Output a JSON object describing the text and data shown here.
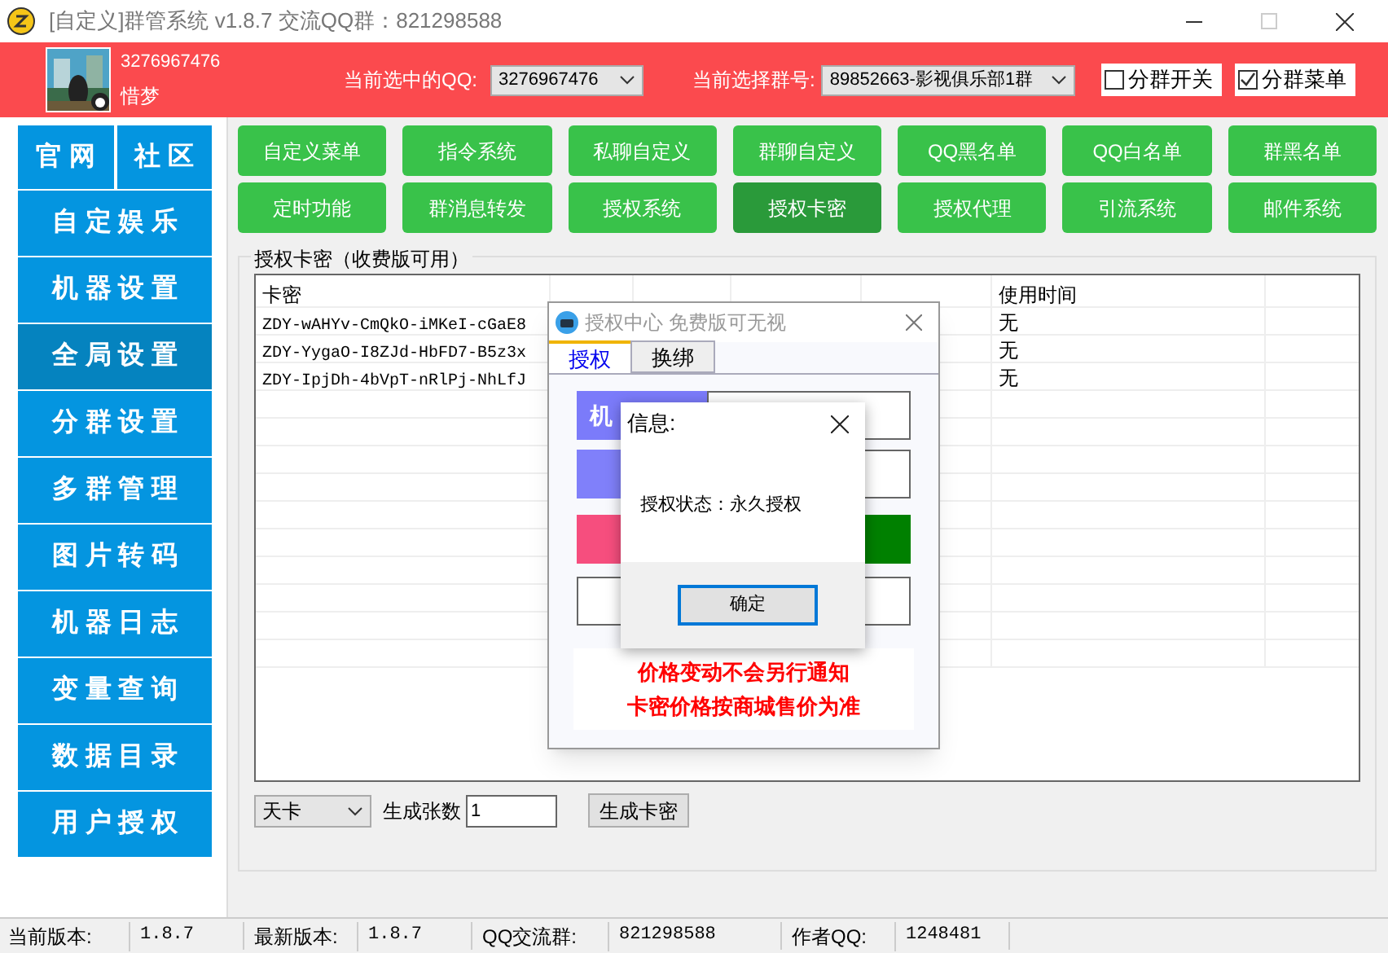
{
  "window": {
    "title": "[自定义]群管系统 v1.8.7 交流QQ群：821298588"
  },
  "header": {
    "account": {
      "qq": "3276967476",
      "nickname": "惜梦"
    },
    "qq_select": {
      "label": "当前选中的QQ:",
      "value": "3276967476"
    },
    "group_select": {
      "label": "当前选择群号:",
      "value": "89852663-影视俱乐部1群"
    },
    "checkboxes": [
      {
        "label": "分群开关",
        "checked": false
      },
      {
        "label": "分群菜单",
        "checked": true
      }
    ]
  },
  "sidebar": {
    "top_links": [
      "官 网",
      "社 区"
    ],
    "items": [
      {
        "label": "自 定 娱 乐",
        "selected": false
      },
      {
        "label": "机 器 设 置",
        "selected": false
      },
      {
        "label": "全 局 设 置",
        "selected": true
      },
      {
        "label": "分 群 设 置",
        "selected": false
      },
      {
        "label": "多 群 管 理",
        "selected": false
      },
      {
        "label": "图 片 转 码",
        "selected": false
      },
      {
        "label": "机 器 日 志",
        "selected": false
      },
      {
        "label": "变 量 查 询",
        "selected": false
      },
      {
        "label": "数 据 目 录",
        "selected": false
      },
      {
        "label": "用 户 授 权",
        "selected": false
      }
    ]
  },
  "feature_buttons": [
    {
      "label": "自定义菜单",
      "selected": false
    },
    {
      "label": "指令系统",
      "selected": false
    },
    {
      "label": "私聊自定义",
      "selected": false
    },
    {
      "label": "群聊自定义",
      "selected": false
    },
    {
      "label": "QQ黑名单",
      "selected": false
    },
    {
      "label": "QQ白名单",
      "selected": false
    },
    {
      "label": "群黑名单",
      "selected": false
    },
    {
      "label": "定时功能",
      "selected": false
    },
    {
      "label": "群消息转发",
      "selected": false
    },
    {
      "label": "授权系统",
      "selected": false
    },
    {
      "label": "授权卡密",
      "selected": true
    },
    {
      "label": "授权代理",
      "selected": false
    },
    {
      "label": "引流系统",
      "selected": false
    },
    {
      "label": "邮件系统",
      "selected": false
    }
  ],
  "panel": {
    "title": "授权卡密（收费版可用）",
    "table": {
      "key_column": "卡密",
      "time_column": "使用时间",
      "rows": [
        {
          "key": "ZDY-wAHYv-CmQkO-iMKeI-cGaE8",
          "used_time": "无"
        },
        {
          "key": "ZDY-YygaO-I8ZJd-HbFD7-B5z3x",
          "used_time": "无"
        },
        {
          "key": "ZDY-IpjDh-4bVpT-nRlPj-NhLfJ",
          "used_time": "无"
        }
      ]
    },
    "card_type": "天卡",
    "count_label": "生成张数",
    "count_value": "1",
    "generate_button": "生成卡密"
  },
  "auth_dialog": {
    "title": "授权中心 免费版可无视",
    "tabs": [
      {
        "label": "授权",
        "selected": true
      },
      {
        "label": "换绑",
        "selected": false
      }
    ],
    "machine_label": "机",
    "notices": [
      "价格变动不会另行通知",
      "卡密价格按商城售价为准"
    ]
  },
  "message_box": {
    "title": "信息:",
    "message": "授权状态：永久授权",
    "ok": "确定"
  },
  "status_bar": [
    {
      "label": "当前版本:",
      "value": "1.8.7"
    },
    {
      "label": "最新版本:",
      "value": "1.8.7"
    },
    {
      "label": "QQ交流群:",
      "value": "821298588"
    },
    {
      "label": "作者QQ:",
      "value": "1248481"
    }
  ]
}
